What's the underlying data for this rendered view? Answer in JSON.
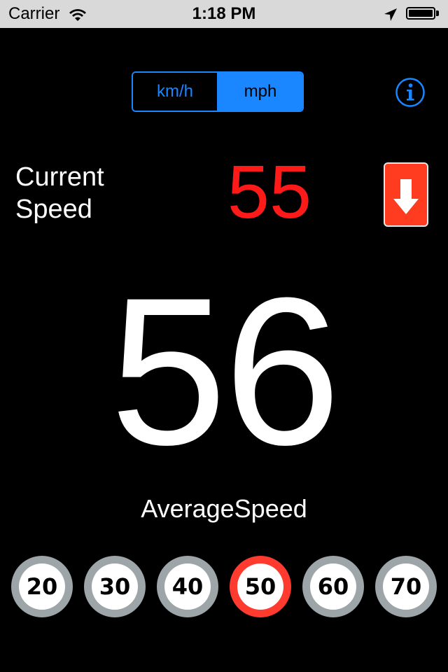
{
  "status_bar": {
    "carrier": "Carrier",
    "time": "1:18 PM",
    "icons": [
      "wifi-icon",
      "location-arrow-icon",
      "battery-icon"
    ]
  },
  "unit_selector": {
    "options": [
      "km/h",
      "mph"
    ],
    "selected": "mph"
  },
  "info_button": {
    "icon": "info-icon"
  },
  "current_speed": {
    "label_line1": "Current",
    "label_line2": "Speed",
    "value": "55",
    "value_color": "#ff1a1a",
    "trend_icon": "arrow-down-icon"
  },
  "average_speed": {
    "value": "56",
    "label": "AverageSpeed"
  },
  "speed_limits": {
    "items": [
      {
        "value": "20",
        "active": false
      },
      {
        "value": "30",
        "active": false
      },
      {
        "value": "40",
        "active": false
      },
      {
        "value": "50",
        "active": true
      },
      {
        "value": "60",
        "active": false
      },
      {
        "value": "70",
        "active": false
      }
    ]
  },
  "colors": {
    "background": "#000000",
    "accent": "#1a86ff",
    "alert": "#ff3b30",
    "limit_ring": "#9ea5a8"
  }
}
